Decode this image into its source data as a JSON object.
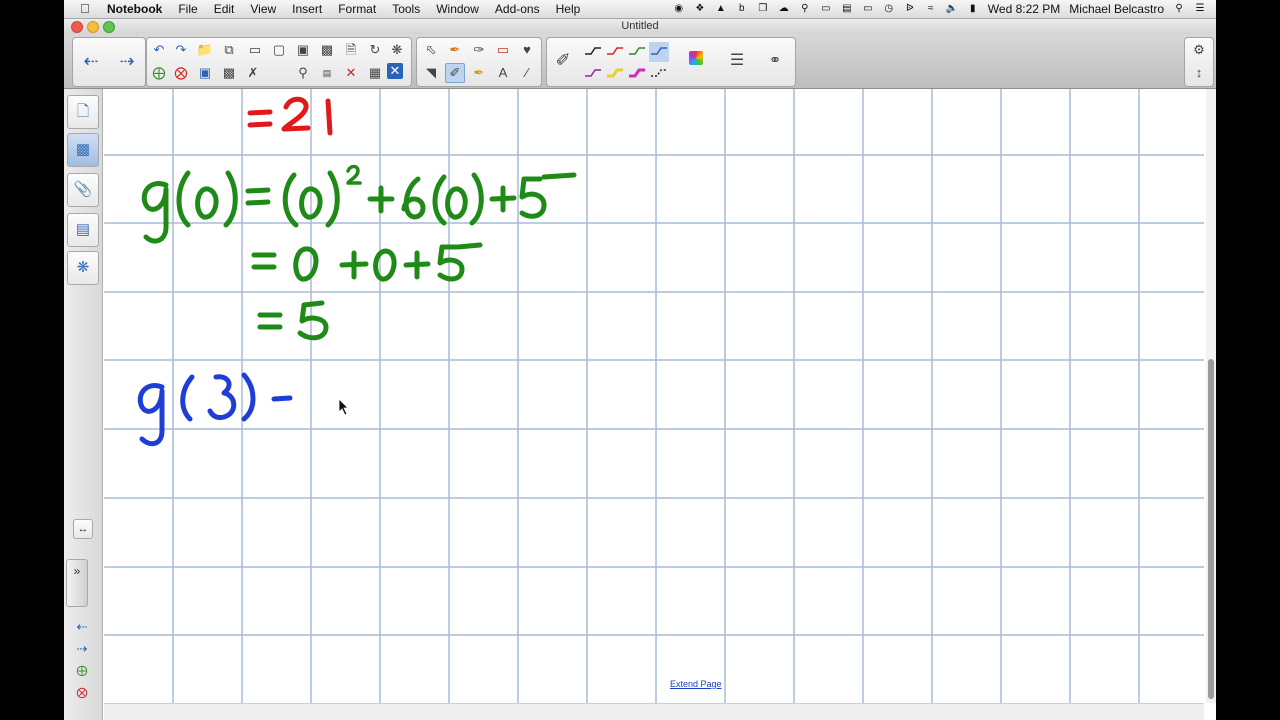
{
  "menubar": {
    "apple": "",
    "items": [
      "Notebook",
      "File",
      "Edit",
      "View",
      "Insert",
      "Format",
      "Tools",
      "Window",
      "Add-ons",
      "Help"
    ],
    "clock": "Wed 8:22 PM",
    "user": "Michael Belcastro"
  },
  "window": {
    "title": "Untitled"
  },
  "canvas": {
    "extend_page": "Extend Page",
    "ink_lines": {
      "line1": "=21",
      "line2": "g(0) = (0)² + 6(0) + 5",
      "line3": "= 0 + 0 + 5",
      "line4": "= 5",
      "line5": "g(3) -"
    }
  },
  "icons": {
    "toolbar": [
      "back-arrow-icon",
      "forward-arrow-icon",
      "undo-icon",
      "redo-icon",
      "open-icon",
      "page-sorter-icon",
      "screen-shade-icon",
      "insert-icon",
      "capture-icon",
      "table-icon",
      "select-icon",
      "pen-icon",
      "eraser-icon",
      "text-icon",
      "line-icon",
      "color-palette-icon",
      "properties-icon",
      "link-icon",
      "gear-icon"
    ],
    "sidebar": [
      "page-sorter-icon",
      "gallery-icon",
      "attachments-icon",
      "properties-icon",
      "addons-icon"
    ]
  },
  "colors": {
    "ink_red": "#e0191c",
    "ink_green": "#1f8a17",
    "ink_blue": "#1f3ed6",
    "grid": "#a9bcd8"
  }
}
